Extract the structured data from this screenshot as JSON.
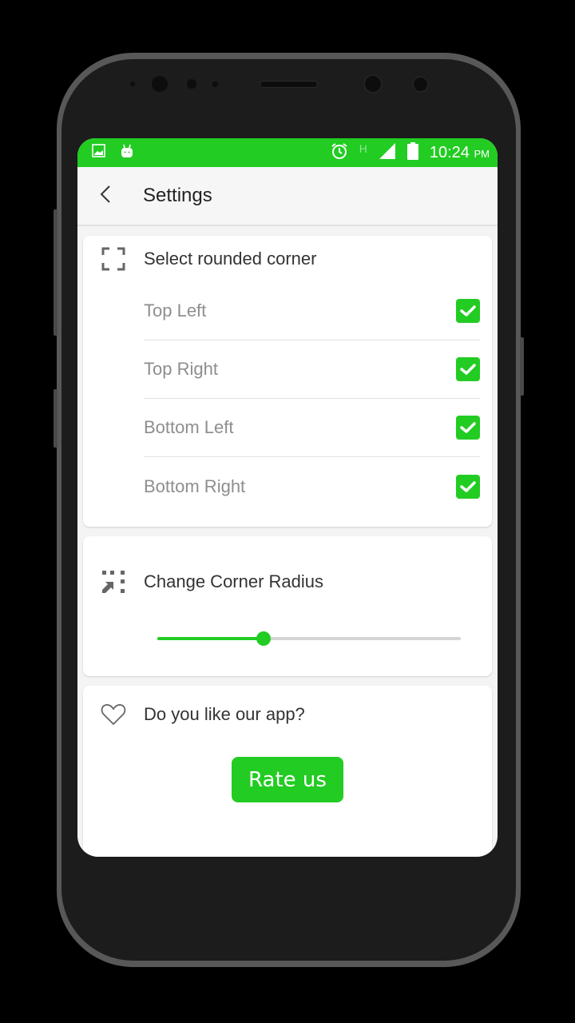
{
  "status_bar": {
    "left_icons": [
      "image-icon",
      "android-icon"
    ],
    "right_icons": [
      "alarm-icon",
      "network-h-icon",
      "signal-icon",
      "battery-icon"
    ],
    "network_type": "H",
    "time": "10:24",
    "ampm": "PM"
  },
  "app_bar": {
    "back_icon": "chevron-left-icon",
    "title": "Settings"
  },
  "corner_card": {
    "icon": "corners-icon",
    "title": "Select rounded corner",
    "options": [
      {
        "label": "Top Left",
        "checked": true
      },
      {
        "label": "Top Right",
        "checked": true
      },
      {
        "label": "Bottom Left",
        "checked": true
      },
      {
        "label": "Bottom Right",
        "checked": true
      }
    ]
  },
  "radius_card": {
    "icon": "resize-icon",
    "title": "Change Corner Radius",
    "slider_value_percent": 35
  },
  "rate_card": {
    "icon": "heart-icon",
    "title": "Do you like our app?",
    "button_label": "Rate us"
  },
  "colors": {
    "accent": "#22cc22",
    "phone_body": "#1c1c1c"
  }
}
